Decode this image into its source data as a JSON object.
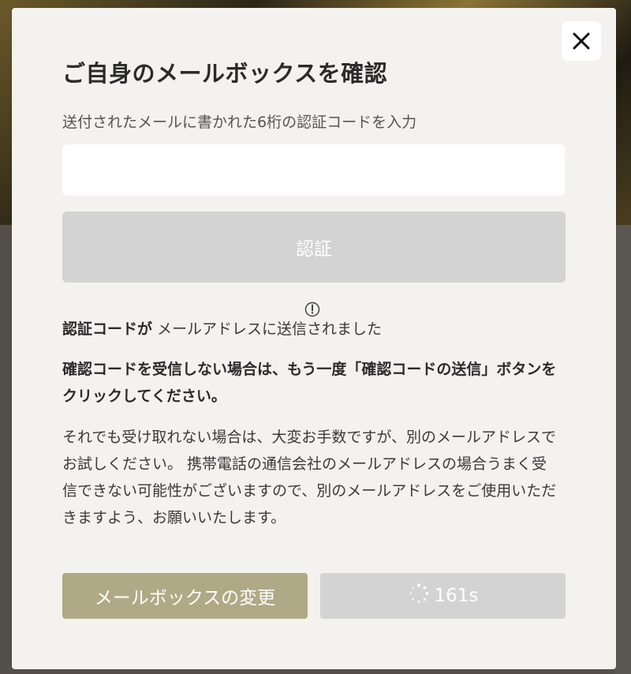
{
  "dialog": {
    "title": "ご自身のメールボックスを確認",
    "instruction": "送付されたメールに書かれた6桁の認証コードを入力",
    "code_input": {
      "value": "",
      "placeholder": ""
    },
    "verify_button": "認証",
    "sent_message": {
      "bold": "認証コードが",
      "rest": " メールアドレスに送信されました"
    },
    "warning": "確認コードを受信しない場合は、もう一度「確認コードの送信」ボタンをクリックしてください。",
    "help": "それでも受け取れない場合は、大変お手数ですが、別のメールアドレスでお試しください。 携帯電話の通信会社のメールアドレスの場合うまく受信できない可能性がございますので、別のメールアドレスをご使用いただきますよう、お願いいたします。",
    "change_mailbox_button": "メールボックスの変更",
    "resend_countdown": "161s"
  },
  "icons": {
    "close": "close-icon",
    "notice": "exclamation-circle-icon",
    "loading": "spinner-icon"
  },
  "colors": {
    "modal_bg": "#f3f2ee",
    "primary_button": "#b0a986",
    "disabled_button": "#d3d3d3",
    "overlay": "#545049"
  }
}
